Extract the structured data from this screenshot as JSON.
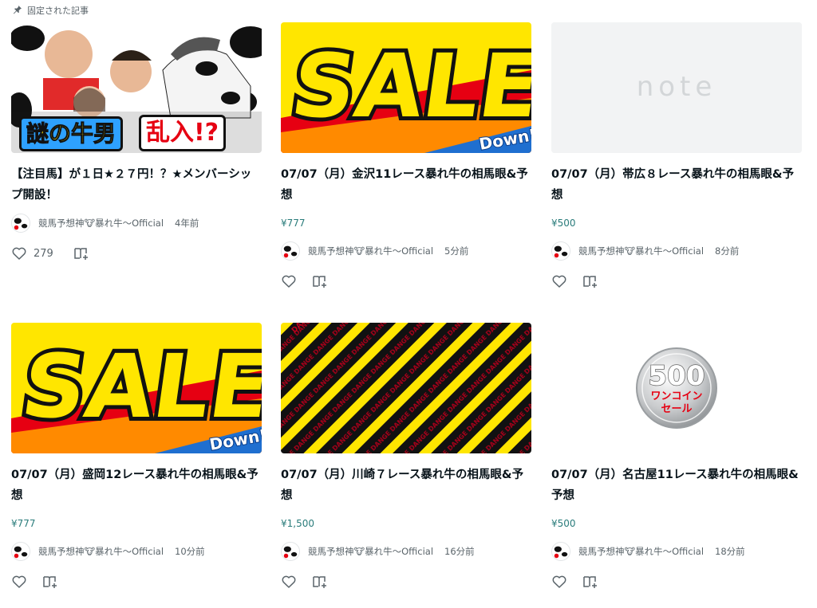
{
  "pinned": {
    "label": "固定された記事",
    "icon": "pin-icon"
  },
  "cards": [
    {
      "thumb_type": "photo-cow-comedians",
      "thumb_text": [
        "謎の牛男",
        "乱入!?"
      ],
      "title": "【注目馬】が１日★２７円！？★メンバーシップ開設！",
      "price": "",
      "author": "競馬予想神🐮暴れ牛〜Official",
      "time": "4年前",
      "likes": "279"
    },
    {
      "thumb_type": "sale",
      "thumb_text": [
        "SALE",
        "Down!"
      ],
      "title": "07/07（月）金沢11レース暴れ牛の相馬眼&予想",
      "price": "¥777",
      "author": "競馬予想神🐮暴れ牛〜Official",
      "time": "5分前",
      "likes": ""
    },
    {
      "thumb_type": "note-placeholder",
      "thumb_text": [
        "note"
      ],
      "title": "07/07（月）帯広８レース暴れ牛の相馬眼&予想",
      "price": "¥500",
      "author": "競馬予想神🐮暴れ牛〜Official",
      "time": "8分前",
      "likes": ""
    },
    {
      "thumb_type": "sale",
      "thumb_text": [
        "SALE",
        "Down!"
      ],
      "title": "07/07（月）盛岡12レース暴れ牛の相馬眼&予想",
      "price": "¥777",
      "author": "競馬予想神🐮暴れ牛〜Official",
      "time": "10分前",
      "likes": ""
    },
    {
      "thumb_type": "danger-stripes",
      "thumb_text": [
        "DANGER"
      ],
      "title": "07/07（月）川崎７レース暴れ牛の相馬眼&予想",
      "price": "¥1,500",
      "author": "競馬予想神🐮暴れ牛〜Official",
      "time": "16分前",
      "likes": ""
    },
    {
      "thumb_type": "one-coin-500",
      "thumb_text": [
        "500",
        "ワンコイン",
        "セール"
      ],
      "title": "07/07（月）名古屋11レース暴れ牛の相馬眼&予想",
      "price": "¥500",
      "author": "競馬予想神🐮暴れ牛〜Official",
      "time": "18分前",
      "likes": ""
    }
  ],
  "icons": {
    "like": "heart-icon",
    "magazine": "add-to-magazine-icon"
  },
  "colors": {
    "price": "#2a7c7b",
    "text": "#08131a",
    "muted": "#5a646a",
    "sale_yellow": "#ffe600",
    "sale_red": "#e60012"
  }
}
